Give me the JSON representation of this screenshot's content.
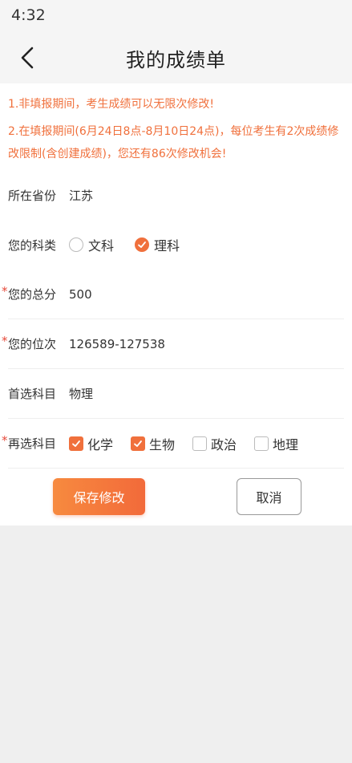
{
  "status": {
    "time": "4:32"
  },
  "nav": {
    "title": "我的成绩单"
  },
  "notice": {
    "line1": "1.非填报期间，考生成绩可以无限次修改!",
    "line2": "2.在填报期间(6月24日8点-8月10日24点)，每位考生有2次成绩修改限制(含创建成绩)，您还有86次修改机会!"
  },
  "form": {
    "province": {
      "label": "所在省份",
      "value": "江苏"
    },
    "category": {
      "label": "您的科类",
      "options": [
        {
          "text": "文科",
          "selected": false
        },
        {
          "text": "理科",
          "selected": true
        }
      ]
    },
    "score": {
      "label": "您的总分",
      "value": "500"
    },
    "rank": {
      "label": "您的位次",
      "value": "126589-127538"
    },
    "first_subject": {
      "label": "首选科目",
      "value": "物理"
    },
    "second_subject": {
      "label": "再选科目",
      "options": [
        {
          "text": "化学",
          "checked": true
        },
        {
          "text": "生物",
          "checked": true
        },
        {
          "text": "政治",
          "checked": false
        },
        {
          "text": "地理",
          "checked": false
        }
      ]
    }
  },
  "buttons": {
    "save": "保存修改",
    "cancel": "取消"
  },
  "colors": {
    "accent": "#f0703c",
    "required": "#e64a3b"
  }
}
